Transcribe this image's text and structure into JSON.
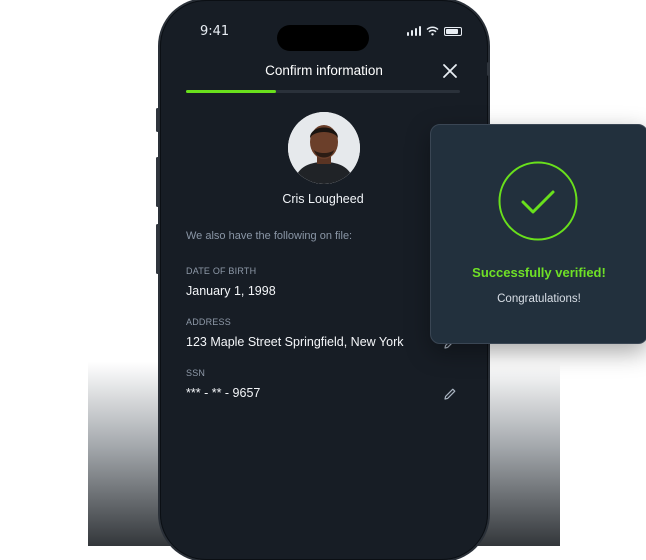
{
  "status": {
    "time": "9:41"
  },
  "header": {
    "title": "Confirm information",
    "progress_fraction": 0.33
  },
  "profile": {
    "name": "Cris Lougheed"
  },
  "intro_text": "We also have the following on file:",
  "fields": [
    {
      "label": "DATE OF BIRTH",
      "value": "January 1, 1998",
      "editable": false
    },
    {
      "label": "ADDRESS",
      "value": "123 Maple Street Springfield, New York",
      "editable": true
    },
    {
      "label": "SSN",
      "value": "*** - ** - 9657",
      "editable": true
    }
  ],
  "toast": {
    "title": "Successfully verified!",
    "subtitle": "Congratulations!"
  },
  "colors": {
    "accent": "#69e01c",
    "background": "#171d25",
    "card": "#22303d"
  },
  "icons": [
    "close-icon",
    "edit-icon",
    "check-circle-icon",
    "signal-icon",
    "wifi-icon",
    "battery-icon"
  ]
}
